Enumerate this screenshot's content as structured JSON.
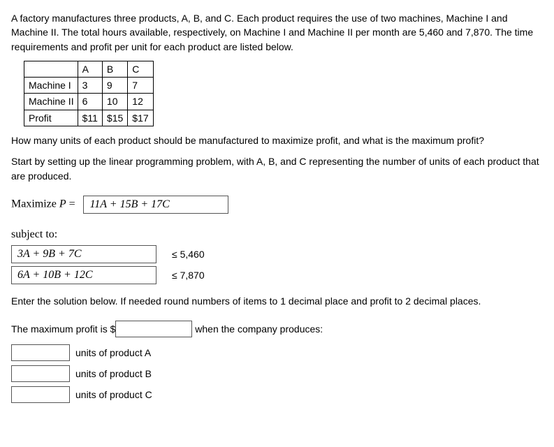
{
  "intro": "A factory manufactures three products, A, B, and C. Each product requires the use of two machines, Machine I and Machine II. The total hours available, respectively, on Machine I and Machine II per month are 5,460 and 7,870. The time requirements and profit per unit for each product are listed below.",
  "table": {
    "cols": [
      "A",
      "B",
      "C"
    ],
    "rows": [
      {
        "label": "Machine I",
        "vals": [
          "3",
          "9",
          "7"
        ]
      },
      {
        "label": "Machine II",
        "vals": [
          "6",
          "10",
          "12"
        ]
      },
      {
        "label": "Profit",
        "vals": [
          "$11",
          "$15",
          "$17"
        ]
      }
    ]
  },
  "question": "How many units of each product should be manufactured to maximize profit, and what is the maximum profit?",
  "setup_instr": "Start by setting up the linear programming problem, with A, B, and C representing the number of units of each product that are produced.",
  "maximize_label_pre": "Maximize ",
  "maximize_label_var": "P",
  "maximize_label_post": " = ",
  "objective": "11A + 15B + 17C",
  "subject_to_label": "subject to:",
  "constraints": [
    {
      "lhs": "3A + 9B + 7C",
      "rhs": "≤ 5,460"
    },
    {
      "lhs": "6A + 10B + 12C",
      "rhs": "≤ 7,870"
    }
  ],
  "solution_instr": "Enter the solution below. If needed round numbers of items to 1 decimal place and profit to 2 decimal places.",
  "profit_sentence_pre": "The maximum profit is $",
  "profit_sentence_post": " when the company produces:",
  "units_labels": [
    "units of product A",
    "units of product B",
    "units of product C"
  ]
}
